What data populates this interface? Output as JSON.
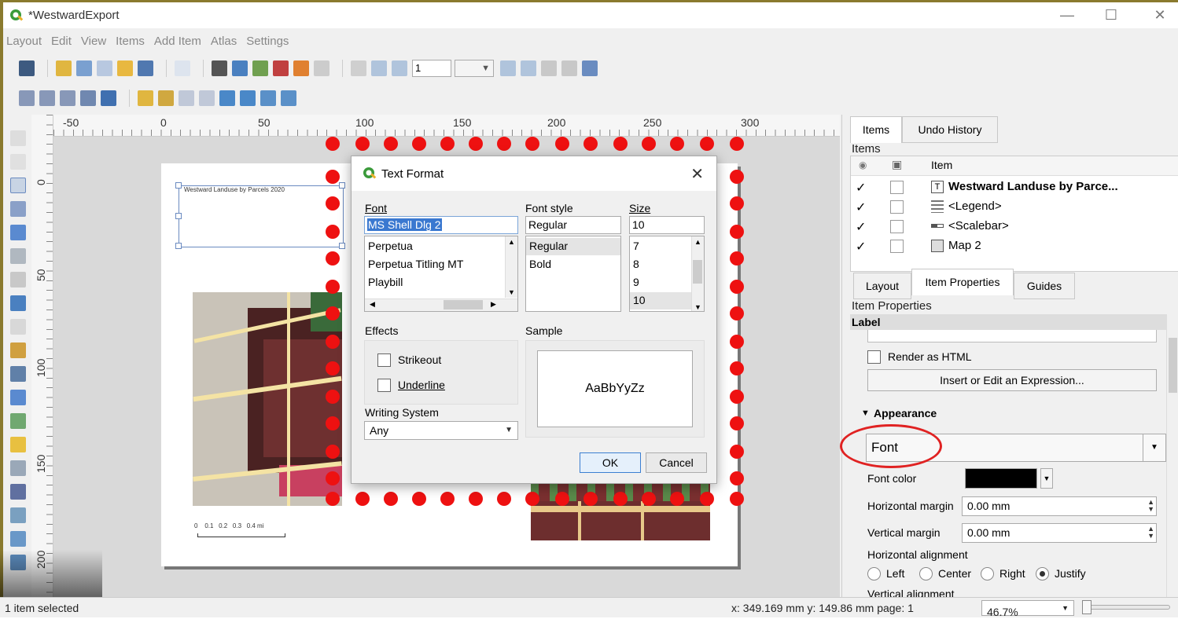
{
  "window": {
    "title": "*WestwardExport"
  },
  "menu": [
    "Layout",
    "Edit",
    "View",
    "Items",
    "Add Item",
    "Atlas",
    "Settings"
  ],
  "toolbar": {
    "page_number": "1"
  },
  "hruler": [
    {
      "label": "-50"
    },
    {
      "label": "0"
    },
    {
      "label": "50"
    },
    {
      "label": "100"
    },
    {
      "label": "150"
    },
    {
      "label": "200"
    },
    {
      "label": "250"
    },
    {
      "label": "300"
    }
  ],
  "vruler": [
    {
      "label": "0"
    },
    {
      "label": "50"
    },
    {
      "label": "100"
    },
    {
      "label": "150"
    },
    {
      "label": "200"
    }
  ],
  "layout_page": {
    "label_text": "Westward Landuse by Parcels 2020",
    "scalebar": "0    0.1   0.2   0.3   0.4 mi"
  },
  "dialog": {
    "title": "Text Format",
    "font_label": "Font",
    "font_value": "MS Shell Dlg 2",
    "font_list": [
      "Perpetua",
      "Perpetua Titling MT",
      "Playbill"
    ],
    "style_label": "Font style",
    "style_value": "Regular",
    "style_list": [
      "Regular",
      "Bold"
    ],
    "size_label": "Size",
    "size_value": "10",
    "size_list": [
      "7",
      "8",
      "9",
      "10"
    ],
    "effects_label": "Effects",
    "strikeout": "Strikeout",
    "underline": "Underline",
    "writing_system_label": "Writing System",
    "writing_system_value": "Any",
    "sample_label": "Sample",
    "sample_text": "AaBbYyZz",
    "ok": "OK",
    "cancel": "Cancel"
  },
  "right_panel": {
    "tabs_top": [
      "Items",
      "Undo History"
    ],
    "items_heading": "Items",
    "items_column": "Item",
    "items": [
      {
        "name": "Westward Landuse by Parce...",
        "type_icon": "T",
        "checked": "✓",
        "bold": true
      },
      {
        "name": "<Legend>",
        "type_icon": "legend-icon",
        "checked": "✓",
        "bold": false
      },
      {
        "name": "<Scalebar>",
        "type_icon": "scalebar-icon",
        "checked": "✓",
        "bold": false
      },
      {
        "name": "Map 2",
        "type_icon": "map-icon",
        "checked": "✓",
        "bold": false
      }
    ],
    "tabs_bottom": [
      "Layout",
      "Item Properties",
      "Guides"
    ],
    "props_heading": "Item Properties",
    "section_label": "Label",
    "render_html": "Render as HTML",
    "insert_expr": "Insert or Edit an Expression...",
    "appearance": "Appearance",
    "font_button": "Font",
    "font_color_label": "Font color",
    "font_color": "#000000",
    "h_margin_label": "Horizontal margin",
    "h_margin": "0.00 mm",
    "v_margin_label": "Vertical margin",
    "v_margin": "0.00 mm",
    "h_align_label": "Horizontal alignment",
    "align_options": [
      "Left",
      "Center",
      "Right",
      "Justify"
    ],
    "align_selected": "Justify",
    "v_align_label": "Vertical alignment"
  },
  "statusbar": {
    "selection": "1 item selected",
    "coords": "x: 349.169 mm y: 149.86 mm page: 1",
    "zoom": "46.7%"
  },
  "colors": {
    "annotation_dots": "#ee1111",
    "highlight_oval": "#e02222",
    "qgis_green": "#3a9a3a"
  }
}
